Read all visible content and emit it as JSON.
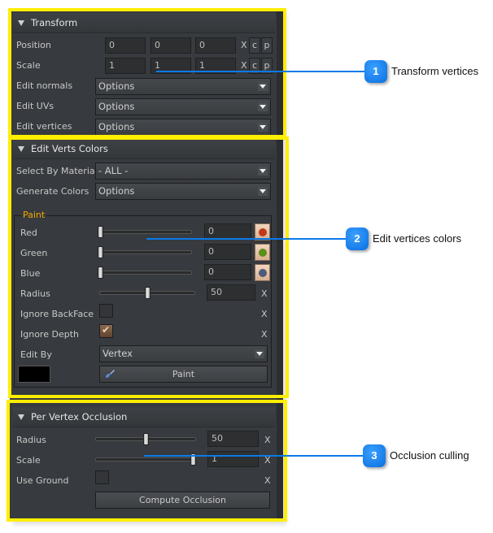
{
  "transform": {
    "title": "Transform",
    "position": {
      "label": "Position",
      "x": "0",
      "y": "0",
      "z": "0",
      "reset": "X",
      "copy": "c",
      "paste": "p"
    },
    "scale": {
      "label": "Scale",
      "x": "1",
      "y": "1",
      "z": "1",
      "reset": "X",
      "copy": "c",
      "paste": "p"
    },
    "edit_normals": {
      "label": "Edit normals",
      "value": "Options"
    },
    "edit_uvs": {
      "label": "Edit UVs",
      "value": "Options"
    },
    "edit_vertices": {
      "label": "Edit vertices",
      "value": "Options"
    }
  },
  "edit_verts_colors": {
    "title": "Edit Verts Colors",
    "select_by_material": {
      "label": "Select By Material",
      "value": "- ALL -"
    },
    "generate_colors": {
      "label": "Generate Colors",
      "value": "Options"
    },
    "paint": {
      "title": "Paint",
      "red": {
        "label": "Red",
        "value": "0",
        "slider_fraction": 0.0,
        "swatch": "#c0391b"
      },
      "green": {
        "label": "Green",
        "value": "0",
        "slider_fraction": 0.0,
        "swatch": "#5a8f1a"
      },
      "blue": {
        "label": "Blue",
        "value": "0",
        "slider_fraction": 0.0,
        "swatch": "#4e5a7a"
      },
      "radius": {
        "label": "Radius",
        "value": "50",
        "slider_fraction": 0.5,
        "reset": "X"
      },
      "ignore_backface": {
        "label": "Ignore BackFace",
        "checked": false,
        "reset": "X"
      },
      "ignore_depth": {
        "label": "Ignore Depth",
        "checked": true,
        "reset": "X"
      },
      "edit_by": {
        "label": "Edit By",
        "value": "Vertex"
      },
      "current_color": "#000000",
      "paint_button": "Paint"
    }
  },
  "per_vertex_occlusion": {
    "title": "Per Vertex Occlusion",
    "radius": {
      "label": "Radius",
      "value": "50",
      "slider_fraction": 0.5,
      "reset": "X"
    },
    "scale": {
      "label": "Scale",
      "value": "1",
      "slider_fraction": 1.0,
      "reset": "X"
    },
    "use_ground": {
      "label": "Use Ground",
      "checked": false,
      "reset": "X"
    },
    "compute_button": "Compute Occlusion"
  },
  "callouts": [
    {
      "number": "1",
      "text": "Transform vertices"
    },
    {
      "number": "2",
      "text": "Edit vertices colors"
    },
    {
      "number": "3",
      "text": "Occlusion culling"
    }
  ],
  "colors": {
    "highlight": "#ffee00",
    "callout": "#0a7ae8",
    "group_title": "#f0a800"
  }
}
